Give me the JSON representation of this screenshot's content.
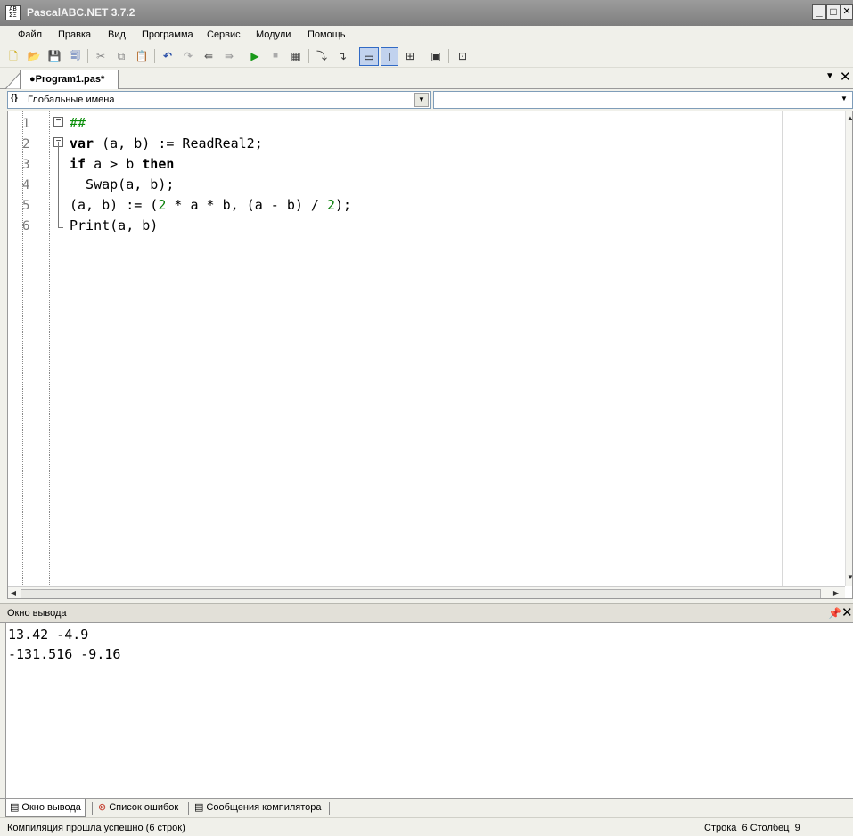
{
  "window": {
    "title": "PascalABC.NET 3.7.2",
    "minimize": "_",
    "maximize": "□",
    "close": "✕"
  },
  "menu": [
    "Файл",
    "Правка",
    "Вид",
    "Программа",
    "Сервис",
    "Модули",
    "Помощь"
  ],
  "tabs": {
    "document": "●Program1.pas*"
  },
  "combos": {
    "left_text": "Глобальные имена",
    "left_icon": "{}",
    "right_text": ""
  },
  "editor": {
    "line_numbers": [
      "1",
      "2",
      "3",
      "4",
      "5",
      "6"
    ]
  },
  "output": {
    "title": "Окно вывода",
    "lines": [
      "13.42 -4.9",
      "-131.516 -9.16"
    ]
  },
  "bottom_tabs": [
    "Окно вывода",
    "Список ошибок",
    "Сообщения компилятора"
  ],
  "status": {
    "message": "Компиляция прошла успешно (6 строк)",
    "row_label": "Строка",
    "row_value": "6",
    "col_label": "Столбец",
    "col_value": "9"
  }
}
